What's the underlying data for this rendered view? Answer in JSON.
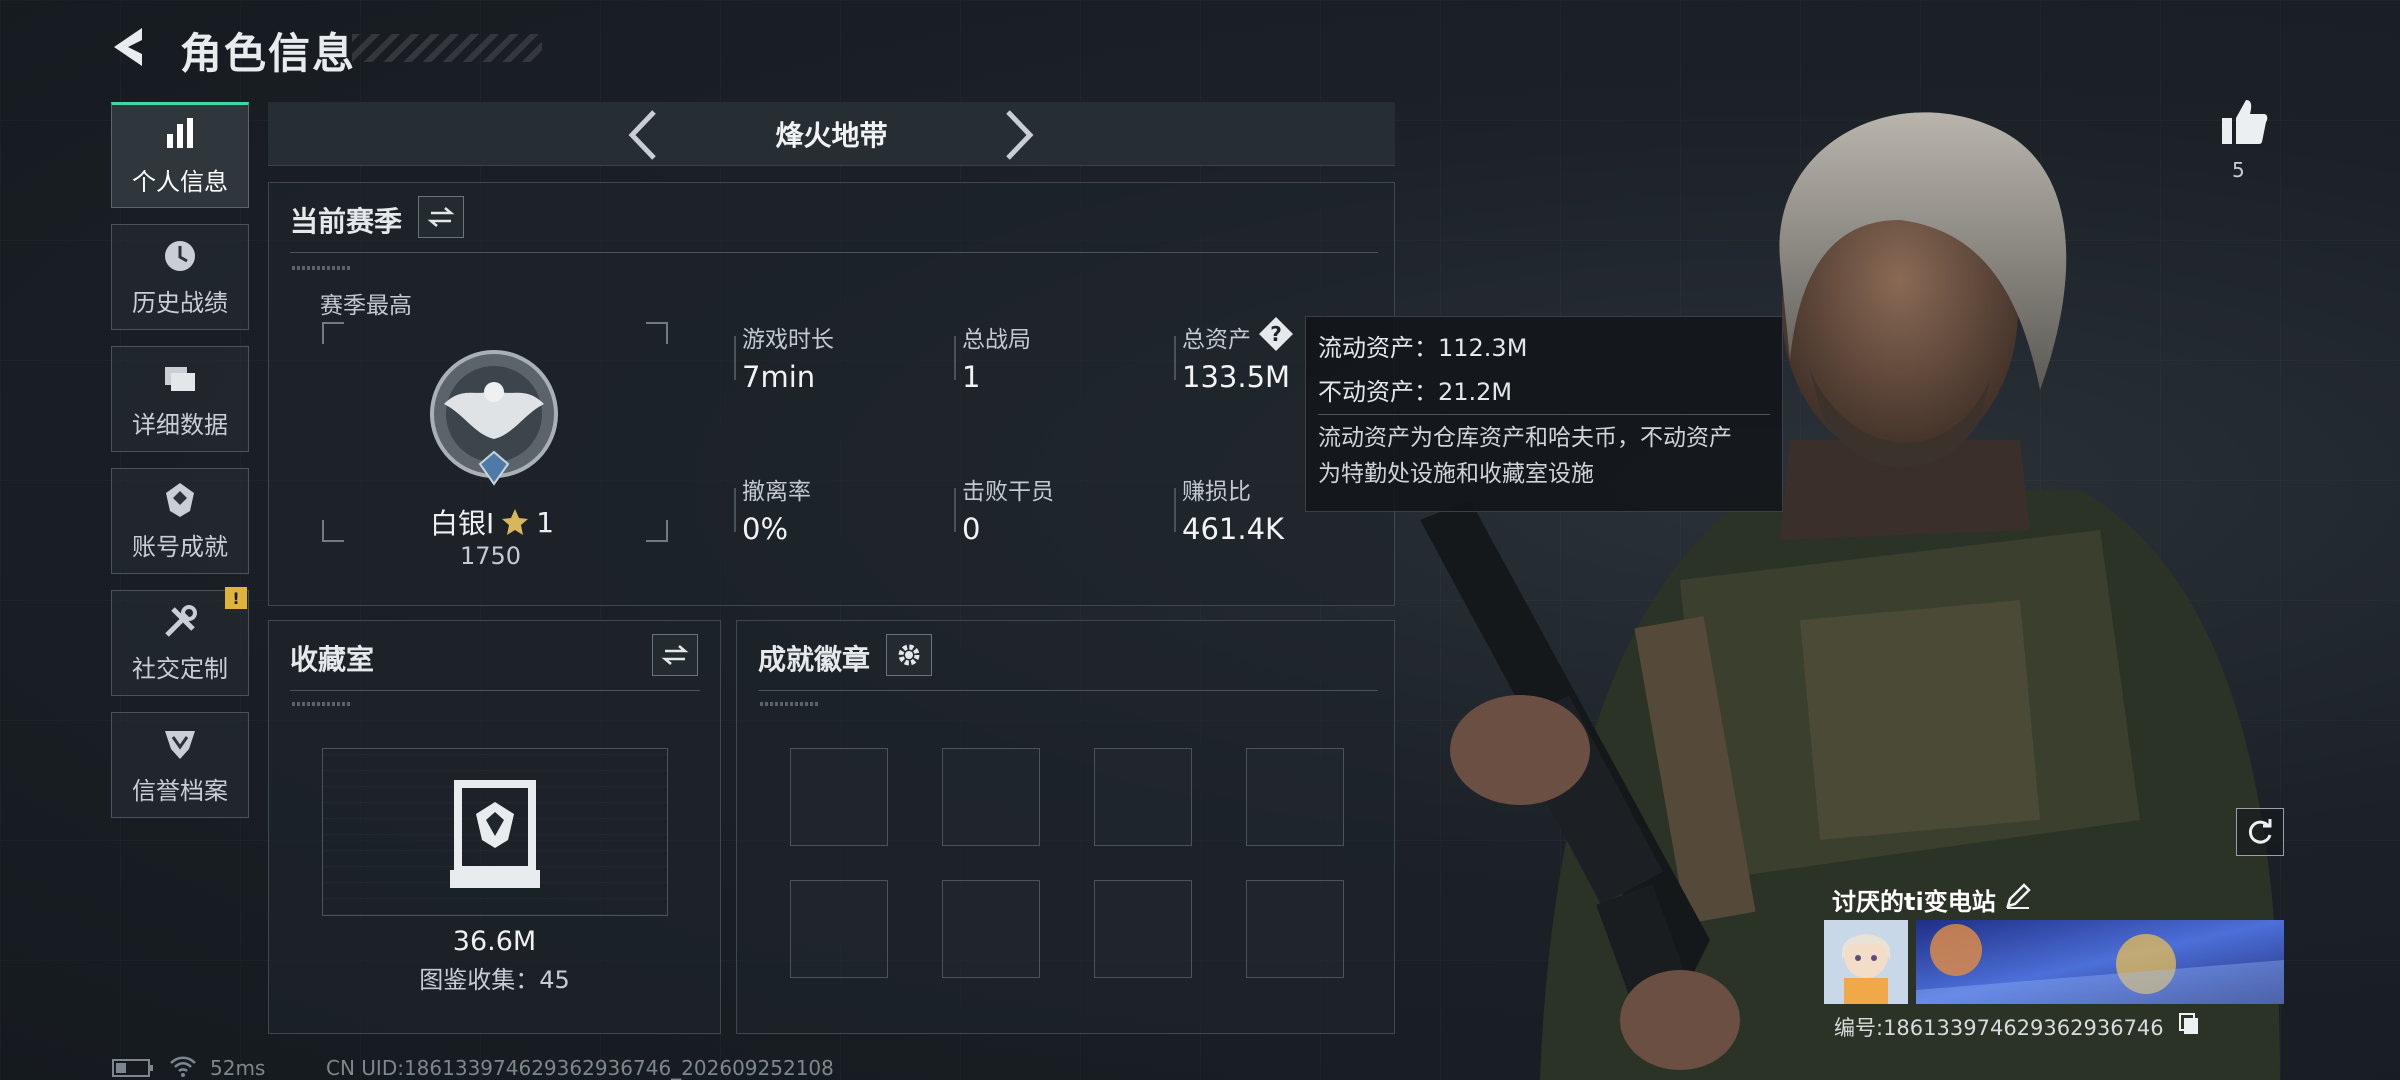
{
  "header": {
    "title": "角色信息"
  },
  "sidebar": {
    "items": [
      {
        "label": "个人信息",
        "icon": "bar-chart-icon",
        "active": true
      },
      {
        "label": "历史战绩",
        "icon": "clock-icon"
      },
      {
        "label": "详细数据",
        "icon": "folder-icon"
      },
      {
        "label": "账号成就",
        "icon": "badge-icon"
      },
      {
        "label": "社交定制",
        "icon": "wrench-icon",
        "badge": "!"
      },
      {
        "label": "信誉档案",
        "icon": "shield-icon"
      }
    ]
  },
  "mode": {
    "label": "烽火地带"
  },
  "season": {
    "title": "当前赛季",
    "best_label": "赛季最高",
    "rank_name": "白银I",
    "rank_star": "1",
    "rank_score": "1750",
    "stats": [
      {
        "label": "游戏时长",
        "value": "7min"
      },
      {
        "label": "总战局",
        "value": "1"
      },
      {
        "label": "总资产",
        "value": "133.5M"
      },
      {
        "label": "撤离率",
        "value": "0%"
      },
      {
        "label": "击败干员",
        "value": "0"
      },
      {
        "label": "赚损比",
        "value": "461.4K"
      }
    ]
  },
  "tooltip": {
    "liquid": "流动资产：112.3M",
    "fixed": "不动资产：21.2M",
    "note_line1": "流动资产为仓库资产和哈夫币，不动资产",
    "note_line2": "为特勤处设施和收藏室设施"
  },
  "collection": {
    "title": "收藏室",
    "value": "36.6M",
    "count_label": "图鉴收集：45"
  },
  "achievements": {
    "title": "成就徽章"
  },
  "profile": {
    "likes": "5",
    "name": "讨厌的ti变电站",
    "id_label": "编号:1861339746293629367​46"
  },
  "footer": {
    "ping": "52ms",
    "uid": "CN UID:18613397462936293674​6_202609252108"
  },
  "colors": {
    "accent": "#3fd7a8",
    "warning": "#e0b43a",
    "background": "#1b2127"
  }
}
